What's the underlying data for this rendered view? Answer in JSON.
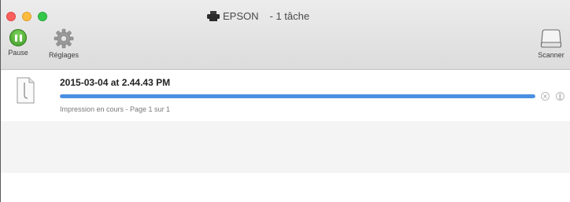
{
  "window": {
    "printer_name": "EPSON",
    "job_count": "- 1 tâche"
  },
  "toolbar": {
    "pause_label": "Pause",
    "settings_label": "Réglages",
    "scanner_label": "Scanner"
  },
  "icons": {
    "title": "printer-icon",
    "pause": "pause-icon",
    "settings": "gear-icon",
    "scanner": "scanner-icon",
    "document": "document-icon",
    "delete": "delete-icon",
    "hold": "hold-icon"
  },
  "colors": {
    "close": "#fc605c",
    "minimize": "#fdbc40",
    "zoom": "#34c84a",
    "pause_button": "#4fb332",
    "progress": "#4a90e2"
  },
  "jobs": [
    {
      "name": "2015-03-04 at 2.44.43 PM",
      "status": "Impression en cours - Page 1 sur 1",
      "progress_fraction": 1.0
    }
  ]
}
